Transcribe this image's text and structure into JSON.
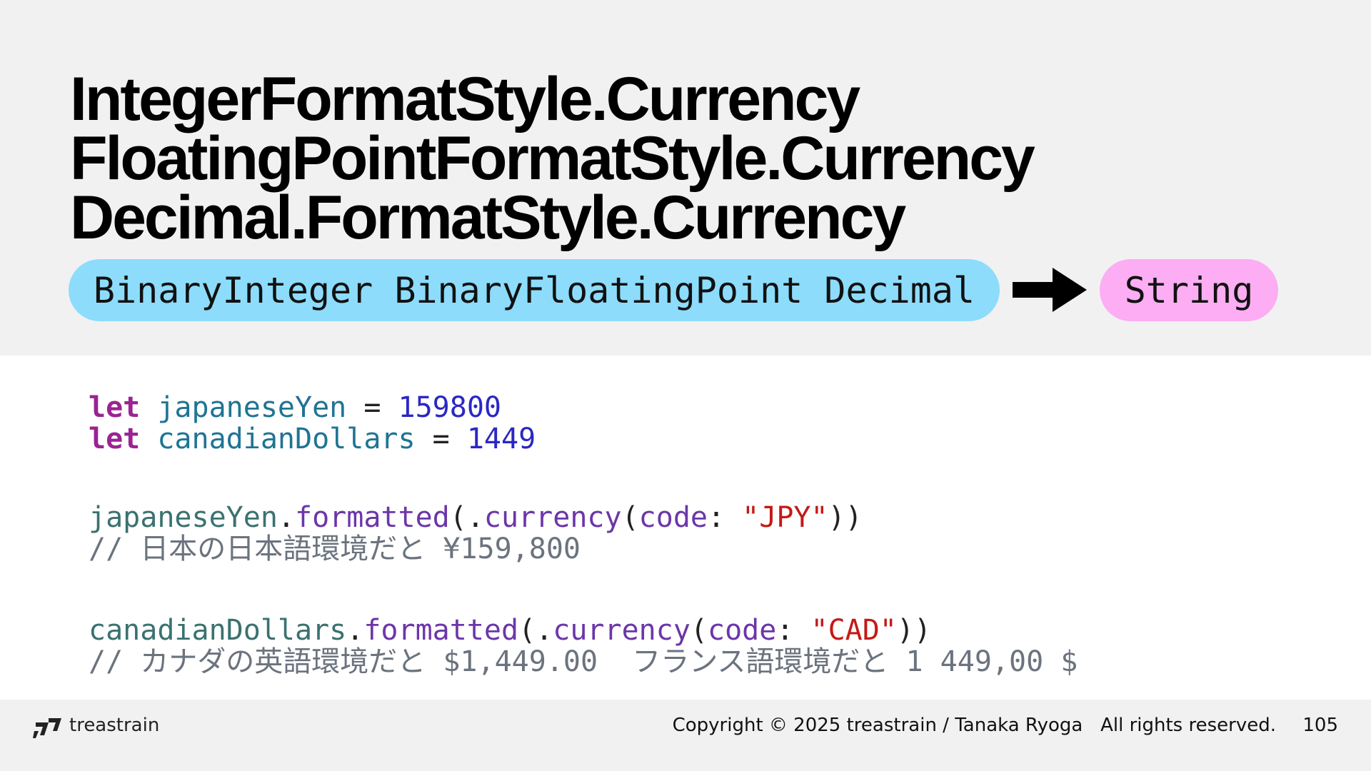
{
  "title_lines": [
    "IntegerFormatStyle.Currency",
    "FloatingPointFormatStyle.Currency",
    "Decimal.FormatStyle.Currency"
  ],
  "input_types": "BinaryInteger BinaryFloatingPoint Decimal",
  "output_type": "String",
  "arrow_icon": "right-arrow-icon",
  "code": {
    "line1": {
      "kw": "let",
      "name": "japaneseYen",
      "eq": " = ",
      "value": "159800"
    },
    "line2": {
      "kw": "let",
      "name": "canadianDollars",
      "eq": " = ",
      "value": "1449"
    },
    "line3": {
      "receiver": "japaneseYen",
      "dot": ".",
      "method": "formatted",
      "paren_open": "(.",
      "style": "currency",
      "paren2": "(",
      "arg": "code",
      "colon": ": ",
      "str": "\"JPY\"",
      "close": "))"
    },
    "comment1": "// 日本の日本語環境だと ¥159,800",
    "line4": {
      "receiver": "canadianDollars",
      "dot": ".",
      "method": "formatted",
      "paren_open": "(.",
      "style": "currency",
      "paren2": "(",
      "arg": "code",
      "colon": ": ",
      "str": "\"CAD\"",
      "close": "))"
    },
    "comment2": "// カナダの英語環境だと $1,449.00  フランス語環境だと 1 449,00 $"
  },
  "colors": {
    "input_pill": "#8ddcfb",
    "output_pill": "#fcadf3",
    "keyword": "#9b2393",
    "string": "#c41a16",
    "number": "#2b27c4"
  },
  "footer": {
    "logo_icon": "treastrain-logo-icon",
    "brand": "treastrain",
    "copyright": "Copyright © 2025 treastrain / Tanaka Ryoga   All rights reserved.",
    "page_number": "105"
  }
}
